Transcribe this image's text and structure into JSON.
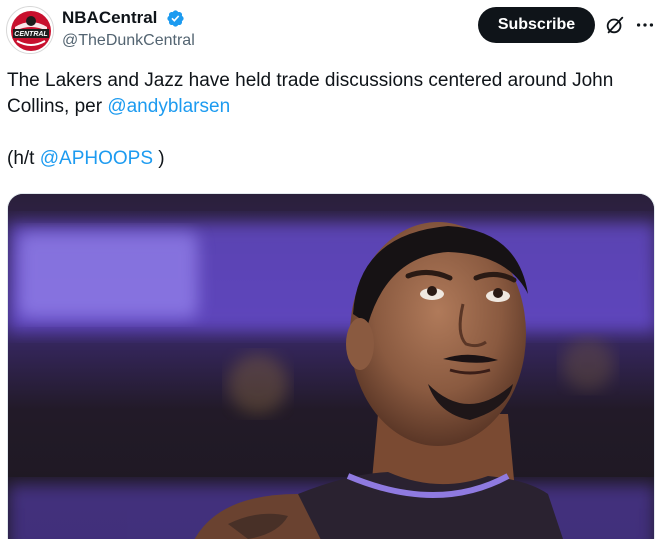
{
  "author": {
    "display_name": "NBACentral",
    "handle": "@TheDunkCentral",
    "avatar_text": "CENTRAL",
    "verified_icon": "verified-badge-icon"
  },
  "actions": {
    "subscribe_label": "Subscribe",
    "grok_icon": "grok-icon",
    "more_icon": "more-options-icon"
  },
  "tweet": {
    "text_part1": "The Lakers and Jazz have held trade discussions centered around John Collins, per ",
    "mention1": "@andyblarsen",
    "ht_prefix": "(h/t ",
    "mention2": "@APHOOPS",
    "ht_suffix": " )"
  },
  "media": {
    "description_icon": "player-photo"
  },
  "colors": {
    "link": "#1d9bf0",
    "text": "#0f1419",
    "secondary": "#536471",
    "button_bg": "#0f1419",
    "verified": "#1d9bf0"
  }
}
